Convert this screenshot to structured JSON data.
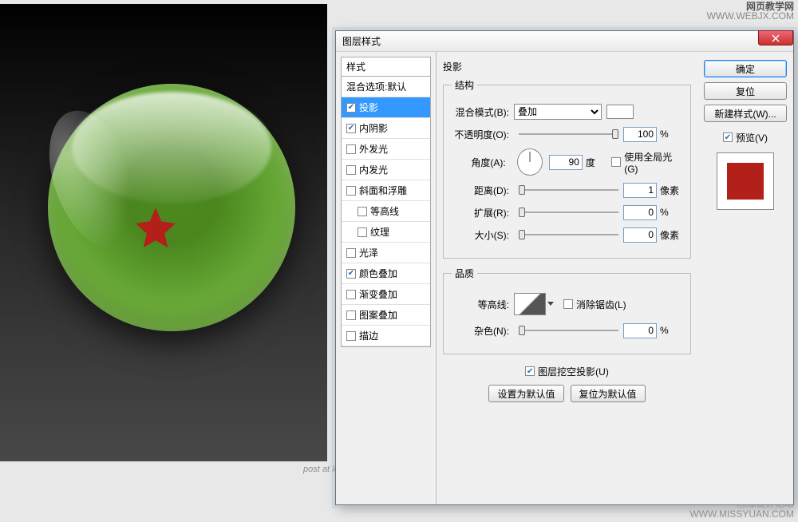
{
  "watermarks": {
    "tr_title": "网页教学网",
    "tr_url": "WWW.WEBJX.COM",
    "br_title": "思缘设计论坛",
    "br_url": "WWW.MISSYUAN.COM",
    "bl_text": "post at leonsao.com"
  },
  "dialog": {
    "title": "图层样式",
    "styles_header": "样式",
    "styles": [
      {
        "label": "混合选项:默认",
        "checked": false,
        "no_cb": true
      },
      {
        "label": "投影",
        "checked": true,
        "selected": true
      },
      {
        "label": "内阴影",
        "checked": true
      },
      {
        "label": "外发光",
        "checked": false
      },
      {
        "label": "内发光",
        "checked": false
      },
      {
        "label": "斜面和浮雕",
        "checked": false
      },
      {
        "label": "等高线",
        "checked": false,
        "indent": true
      },
      {
        "label": "纹理",
        "checked": false,
        "indent": true
      },
      {
        "label": "光泽",
        "checked": false
      },
      {
        "label": "颜色叠加",
        "checked": true
      },
      {
        "label": "渐变叠加",
        "checked": false
      },
      {
        "label": "图案叠加",
        "checked": false
      },
      {
        "label": "描边",
        "checked": false
      }
    ],
    "panel_title": "投影",
    "structure": {
      "legend": "结构",
      "blend_mode_label": "混合模式(B):",
      "blend_mode_value": "叠加",
      "opacity_label": "不透明度(O):",
      "opacity_value": "100",
      "opacity_unit": "%",
      "angle_label": "角度(A):",
      "angle_value": "90",
      "angle_unit": "度",
      "global_light_label": "使用全局光(G)",
      "global_light_checked": false,
      "distance_label": "距离(D):",
      "distance_value": "1",
      "distance_unit": "像素",
      "spread_label": "扩展(R):",
      "spread_value": "0",
      "spread_unit": "%",
      "size_label": "大小(S):",
      "size_value": "0",
      "size_unit": "像素"
    },
    "quality": {
      "legend": "品质",
      "contour_label": "等高线:",
      "antialias_label": "消除锯齿(L)",
      "antialias_checked": false,
      "noise_label": "杂色(N):",
      "noise_value": "0",
      "noise_unit": "%"
    },
    "knockout_label": "图层挖空投影(U)",
    "knockout_checked": true,
    "set_default": "设置为默认值",
    "reset_default": "复位为默认值",
    "buttons": {
      "ok": "确定",
      "cancel": "复位",
      "new_style": "新建样式(W)...",
      "preview_label": "预览(V)",
      "preview_checked": true
    }
  }
}
